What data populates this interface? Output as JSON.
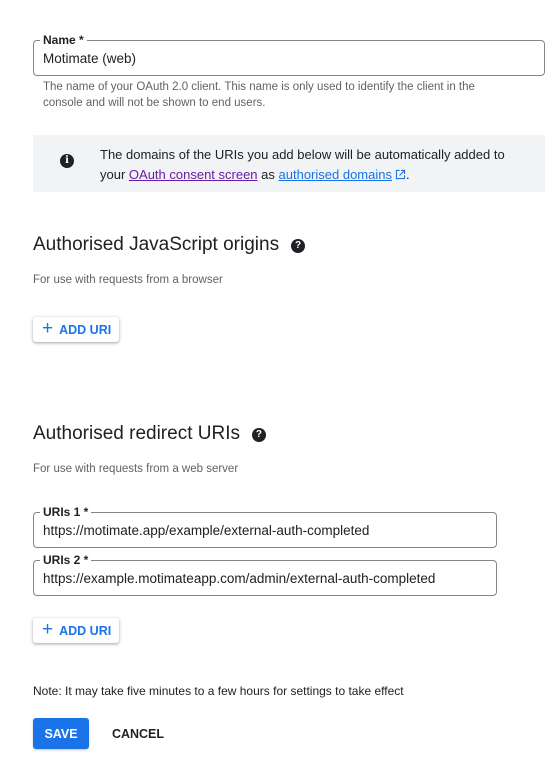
{
  "name_field": {
    "label": "Name *",
    "value": "Motimate (web)",
    "hint": "The name of your OAuth 2.0 client. This name is only used to identify the client in the console and will not be shown to end users."
  },
  "info": {
    "icon": "info-icon",
    "text_before": "The domains of the URIs you add below will be automatically added to your ",
    "link1": "OAuth consent screen",
    "text_mid": " as ",
    "link2": "authorised domains",
    "text_end": "."
  },
  "js_origins": {
    "title": "Authorised JavaScript origins",
    "subtitle": "For use with requests from a browser",
    "add_label": "ADD URI"
  },
  "redirect_uris": {
    "title": "Authorised redirect URIs",
    "subtitle": "For use with requests from a web server",
    "uris": [
      {
        "label": "URIs 1 *",
        "value": "https://motimate.app/example/external-auth-completed"
      },
      {
        "label": "URIs 2 *",
        "value": "https://example.motimateapp.com/admin/external-auth-completed"
      }
    ],
    "add_label": "ADD URI"
  },
  "note": "Note: It may take five minutes to a few hours for settings to take effect",
  "actions": {
    "save": "SAVE",
    "cancel": "CANCEL"
  },
  "colors": {
    "accent": "#1a73e8",
    "visited_link": "#681da8",
    "info_bg": "#f1f3f4"
  }
}
